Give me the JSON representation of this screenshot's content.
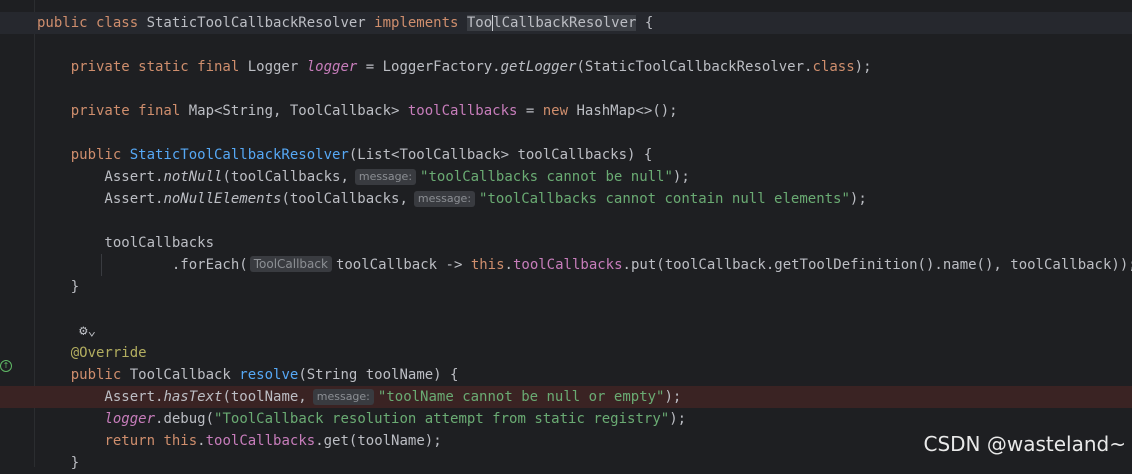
{
  "editor": {
    "lines": [
      [
        {
          "t": "public class ",
          "c": "kw"
        },
        {
          "t": "StaticToolCallbackResolver ",
          "c": "type"
        },
        {
          "t": "implements ",
          "c": "kw"
        },
        {
          "t": "Too",
          "c": "selword"
        },
        {
          "t": "",
          "c": "caret"
        },
        {
          "t": "lCallbackResolver",
          "c": "selword"
        },
        {
          "t": " {",
          "c": "type"
        }
      ],
      [],
      [
        {
          "t": "    private static final ",
          "c": "kw"
        },
        {
          "t": "Logger ",
          "c": "type"
        },
        {
          "t": "logger",
          "c": "fldi"
        },
        {
          "t": " = LoggerFactory.",
          "c": "type"
        },
        {
          "t": "getLogger",
          "c": "sfn"
        },
        {
          "t": "(StaticToolCallbackResolver.",
          "c": "type"
        },
        {
          "t": "class",
          "c": "kw"
        },
        {
          "t": ");",
          "c": "type"
        }
      ],
      [],
      [
        {
          "t": "    private final ",
          "c": "kw"
        },
        {
          "t": "Map<String, ToolCallback> ",
          "c": "type"
        },
        {
          "t": "toolCallbacks",
          "c": "fld"
        },
        {
          "t": " = ",
          "c": "type"
        },
        {
          "t": "new ",
          "c": "kw"
        },
        {
          "t": "HashMap<>();",
          "c": "type"
        }
      ],
      [],
      [
        {
          "t": "    public ",
          "c": "kw"
        },
        {
          "t": "StaticToolCallbackResolver",
          "c": "decl"
        },
        {
          "t": "(List<ToolCallback> toolCallbacks) {",
          "c": "type"
        }
      ],
      [
        {
          "t": "        Assert.",
          "c": "type"
        },
        {
          "t": "notNull",
          "c": "sfn"
        },
        {
          "t": "(toolCallbacks,",
          "c": "type"
        },
        {
          "hint": "message:"
        },
        {
          "t": "\"toolCallbacks cannot be null\"",
          "c": "str"
        },
        {
          "t": ");",
          "c": "type"
        }
      ],
      [
        {
          "t": "        Assert.",
          "c": "type"
        },
        {
          "t": "noNullElements",
          "c": "sfn"
        },
        {
          "t": "(toolCallbacks,",
          "c": "type"
        },
        {
          "hint": "message:"
        },
        {
          "t": "\"toolCallbacks cannot contain null elements\"",
          "c": "str"
        },
        {
          "t": ");",
          "c": "type"
        }
      ],
      [],
      [
        {
          "t": "        toolCallbacks",
          "c": "type"
        }
      ],
      [
        {
          "t": "                .forEach(",
          "c": "type"
        },
        {
          "hint": "ToolCallback",
          "big": true
        },
        {
          "t": "toolCallback -> ",
          "c": "type"
        },
        {
          "t": "this",
          "c": "kw"
        },
        {
          "t": ".",
          "c": "type"
        },
        {
          "t": "toolCallbacks",
          "c": "fld"
        },
        {
          "t": ".put(toolCallback.getToolDefinition().name(), toolCallback));",
          "c": "type"
        }
      ],
      [
        {
          "t": "    }",
          "c": "type"
        }
      ],
      [],
      [
        {
          "t": "     ",
          "c": "type"
        },
        {
          "t": "⚙⌄",
          "c": "type"
        }
      ],
      [
        {
          "t": "    @Override",
          "c": "ann"
        }
      ],
      [
        {
          "t": "    public ",
          "c": "kw"
        },
        {
          "t": "ToolCallback ",
          "c": "type"
        },
        {
          "t": "resolve",
          "c": "decl"
        },
        {
          "t": "(String toolName) {",
          "c": "type"
        }
      ],
      [
        {
          "t": "        Assert.",
          "c": "type"
        },
        {
          "t": "hasText",
          "c": "sfn"
        },
        {
          "t": "(toolName,",
          "c": "type"
        },
        {
          "hint": "message:"
        },
        {
          "t": "\"toolName cannot be null or empty\"",
          "c": "str"
        },
        {
          "t": ");",
          "c": "type"
        }
      ],
      [
        {
          "t": "        ",
          "c": "type"
        },
        {
          "t": "logger",
          "c": "fldi"
        },
        {
          "t": ".debug(",
          "c": "type"
        },
        {
          "t": "\"ToolCallback resolution attempt from static registry\"",
          "c": "str"
        },
        {
          "t": ");",
          "c": "type"
        }
      ],
      [
        {
          "t": "        ",
          "c": "type"
        },
        {
          "t": "return ",
          "c": "kw"
        },
        {
          "t": "this",
          "c": "kw"
        },
        {
          "t": ".",
          "c": "type"
        },
        {
          "t": "toolCallbacks",
          "c": "fld"
        },
        {
          "t": ".get(toolName);",
          "c": "type"
        }
      ],
      [
        {
          "t": "    }",
          "c": "type"
        }
      ]
    ],
    "current_line": 0,
    "breakpoint_line": 17
  },
  "watermark": "CSDN @wasteland~",
  "colors": {
    "background": "#1e1f22",
    "keyword": "#cf8e6d",
    "string": "#6aab73",
    "field": "#c77dbb",
    "declaration": "#56a8f5",
    "annotation": "#b3ae60"
  }
}
